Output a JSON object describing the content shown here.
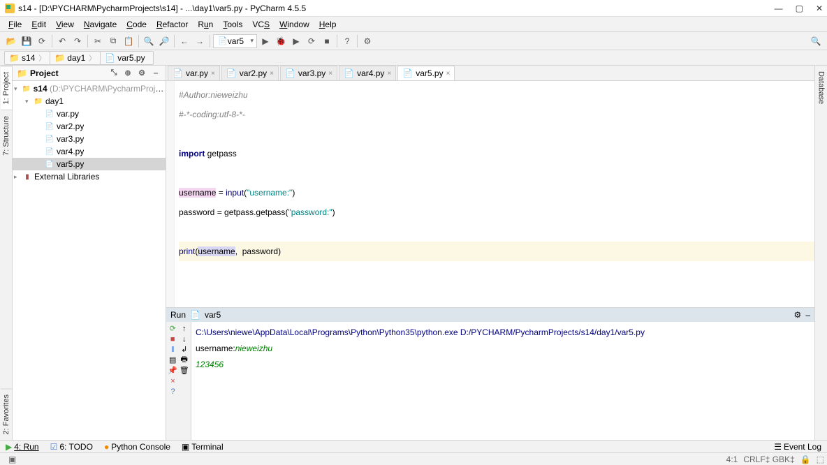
{
  "window": {
    "title": "s14 - [D:\\PYCHARM\\PycharmProjects\\s14] - ...\\day1\\var5.py - PyCharm 4.5.5"
  },
  "menu": [
    "File",
    "Edit",
    "View",
    "Navigate",
    "Code",
    "Refactor",
    "Run",
    "Tools",
    "VCS",
    "Window",
    "Help"
  ],
  "toolbar": {
    "combo": "var5"
  },
  "breadcrumb": [
    "s14",
    "day1",
    "var5.py"
  ],
  "sideTabs": {
    "project": "1: Project",
    "structure": "7: Structure",
    "favorites": "2: Favorites",
    "database": "Database"
  },
  "projectPanel": {
    "title": "Project"
  },
  "tree": {
    "root": {
      "label": "s14",
      "pathSuffix": " (D:\\PYCHARM\\PycharmProjects\\"
    },
    "folder": "day1",
    "files": [
      "var.py",
      "var2.py",
      "var3.py",
      "var4.py",
      "var5.py"
    ],
    "selectedIndex": 4,
    "external": "External Libraries"
  },
  "editorTabs": [
    "var.py",
    "var2.py",
    "var3.py",
    "var4.py",
    "var5.py"
  ],
  "activeEditorTab": 4,
  "code": {
    "l1": "#Author:nieweizhu",
    "l2": "#-*-coding:utf-8-*-",
    "l3": "",
    "l4_kw": "import",
    "l4_rest": " getpass",
    "l5": "",
    "l6_var": "username",
    "l6_eq": " = ",
    "l6_fn": "input",
    "l6_open": "(",
    "l6_str": "\"username:\"",
    "l6_close": ")",
    "l7_var": "password",
    "l7_eq": " = getpass.",
    "l7_fn": "getpass",
    "l7_open": "(",
    "l7_str": "\"password:\"",
    "l7_close": ")",
    "l8": "",
    "l9_fn": "print",
    "l9_open": "(",
    "l9_a": "username",
    "l9_sep": ", ",
    "l9_b": " password",
    "l9_close": ")"
  },
  "run": {
    "title": "Run",
    "config": "var5",
    "cmd": "C:\\Users\\niewe\\AppData\\Local\\Programs\\Python\\Python35\\python.exe D:/PYCHARM/PycharmProjects/s14/day1/var5.py",
    "prompt": "username:",
    "input1": "nieweizhu",
    "input2": "123456"
  },
  "bottomTabs": {
    "run": "4: Run",
    "todo": "6: TODO",
    "console": "Python Console",
    "terminal": "Terminal",
    "eventlog": "Event Log"
  },
  "status": {
    "pos": "4:1",
    "enc": "CRLF‡ GBK‡",
    "lock": "🔒",
    "more": "⬚"
  }
}
